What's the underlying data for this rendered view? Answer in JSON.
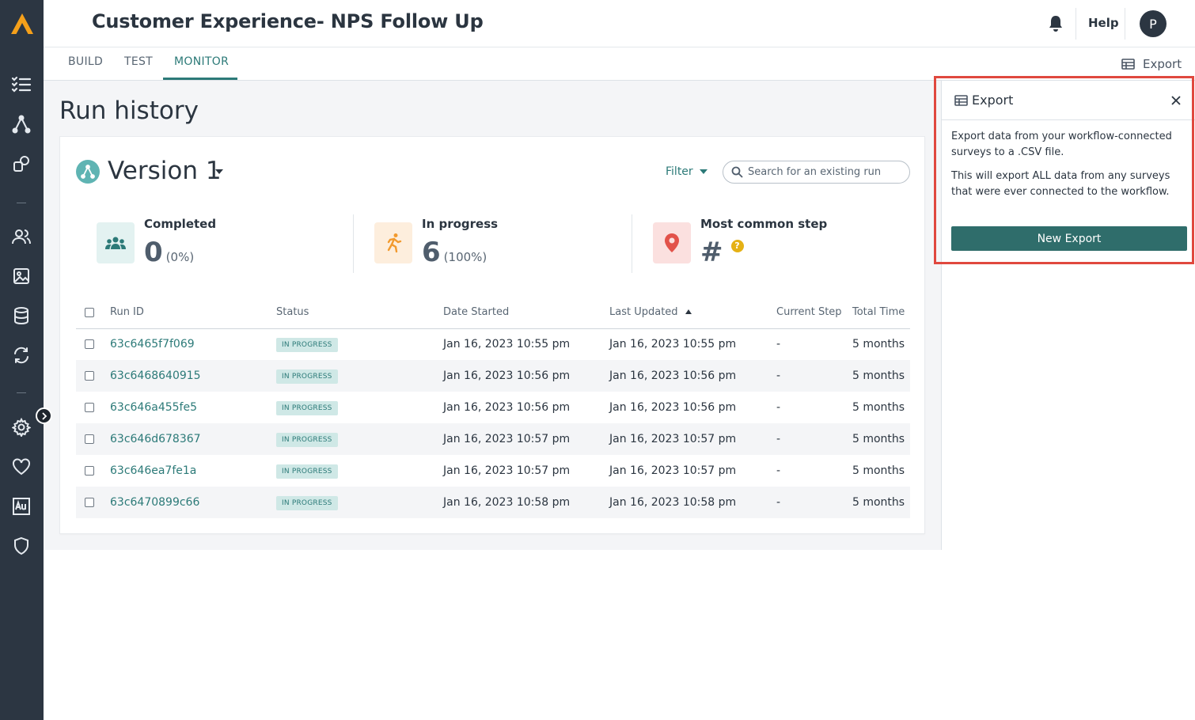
{
  "app": {
    "title": "Customer Experience- NPS Follow Up"
  },
  "header": {
    "help_label": "Help",
    "avatar_initial": "P",
    "bell_icon": "bell-icon"
  },
  "tabs": [
    {
      "label": "BUILD",
      "active": false
    },
    {
      "label": "TEST",
      "active": false
    },
    {
      "label": "MONITOR",
      "active": true
    }
  ],
  "toolbar": {
    "export_label": "Export"
  },
  "sidebar": {
    "icons": [
      "logo-icon",
      "checklist-icon",
      "workflow-icon",
      "integrations-icon",
      "people-icon",
      "image-icon",
      "database-icon",
      "sync-icon",
      "settings-icon",
      "heart-icon",
      "font-icon",
      "shield-icon"
    ]
  },
  "page": {
    "title": "Run history"
  },
  "version": {
    "label": "Version 1"
  },
  "filter": {
    "label": "Filter"
  },
  "search": {
    "placeholder": "Search for an existing run"
  },
  "stats": {
    "completed": {
      "label": "Completed",
      "value": "0",
      "pct": "(0%)"
    },
    "in_progress": {
      "label": "In progress",
      "value": "6",
      "pct": "(100%)"
    },
    "most_common": {
      "label": "Most common step",
      "value": "#",
      "help": "?"
    }
  },
  "table": {
    "headers": {
      "run_id": "Run ID",
      "status": "Status",
      "date_started": "Date Started",
      "last_updated": "Last Updated",
      "current_step": "Current Step",
      "total_time": "Total Time"
    },
    "sorted_column": "Last Updated",
    "sort_direction": "ascending",
    "rows": [
      {
        "id": "63c6465f7f069",
        "status": "IN PROGRESS",
        "started": "Jan 16, 2023 10:55 pm",
        "updated": "Jan 16, 2023 10:55 pm",
        "step": "-",
        "total": "5 months"
      },
      {
        "id": "63c6468640915",
        "status": "IN PROGRESS",
        "started": "Jan 16, 2023 10:56 pm",
        "updated": "Jan 16, 2023 10:56 pm",
        "step": "-",
        "total": "5 months"
      },
      {
        "id": "63c646a455fe5",
        "status": "IN PROGRESS",
        "started": "Jan 16, 2023 10:56 pm",
        "updated": "Jan 16, 2023 10:56 pm",
        "step": "-",
        "total": "5 months"
      },
      {
        "id": "63c646d678367",
        "status": "IN PROGRESS",
        "started": "Jan 16, 2023 10:57 pm",
        "updated": "Jan 16, 2023 10:57 pm",
        "step": "-",
        "total": "5 months"
      },
      {
        "id": "63c646ea7fe1a",
        "status": "IN PROGRESS",
        "started": "Jan 16, 2023 10:57 pm",
        "updated": "Jan 16, 2023 10:57 pm",
        "step": "-",
        "total": "5 months"
      },
      {
        "id": "63c6470899c66",
        "status": "IN PROGRESS",
        "started": "Jan 16, 2023 10:58 pm",
        "updated": "Jan 16, 2023 10:58 pm",
        "step": "-",
        "total": "5 months"
      }
    ]
  },
  "export_panel": {
    "title": "Export",
    "description_1": "Export data from your workflow-connected surveys to a .CSV file.",
    "description_2": "This will export ALL data from any surveys that were ever connected to the workflow.",
    "button_label": "New Export"
  },
  "colors": {
    "accent": "#2c7a78",
    "rail": "#2c3642",
    "highlight": "#e0483e",
    "logo": "#f5a01a"
  }
}
